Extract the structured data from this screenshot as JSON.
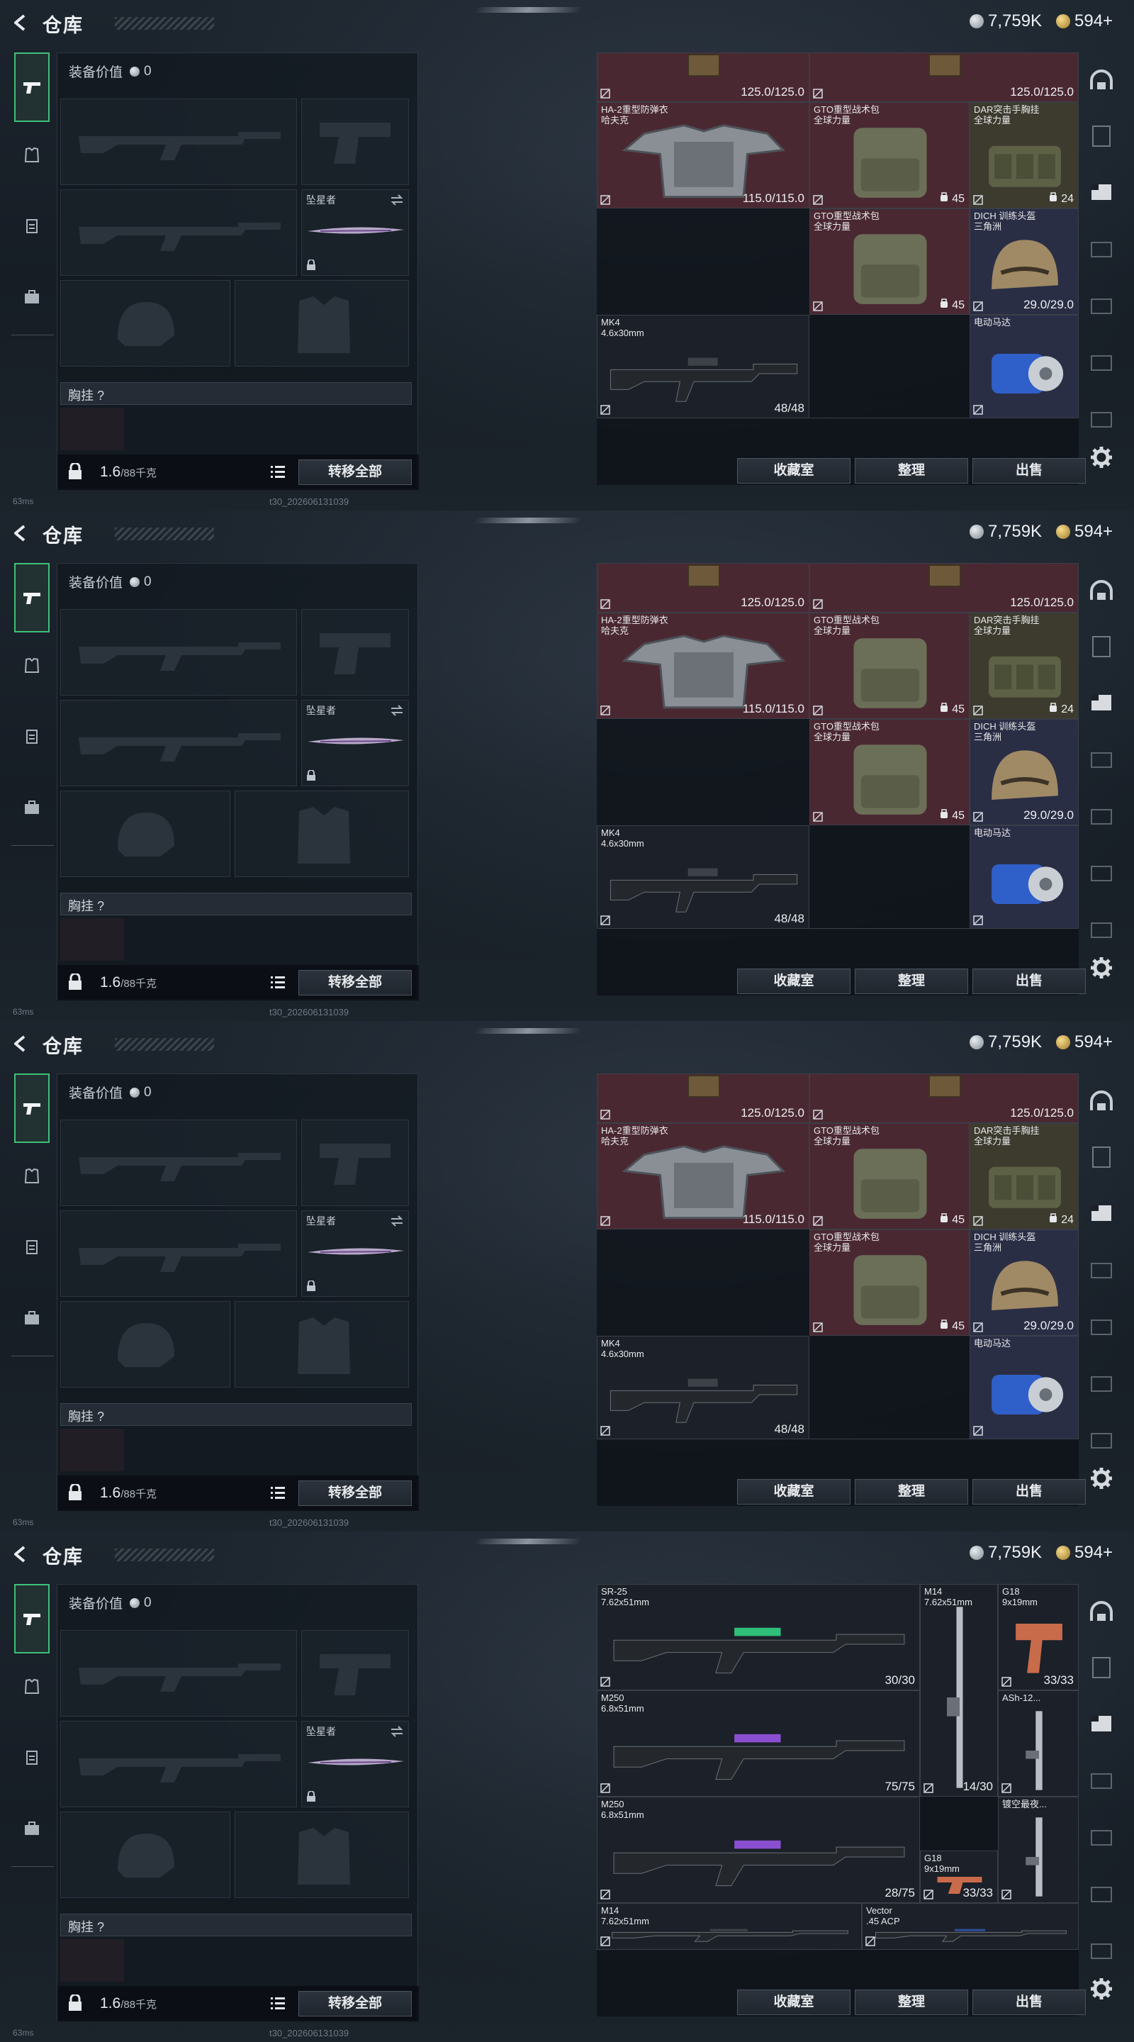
{
  "header": {
    "title": "仓库",
    "silver": "7,759K",
    "gold": "594+"
  },
  "equipment": {
    "value_label": "装备价值",
    "value": "0",
    "melee_name": "坠星者",
    "chest_label": "胸挂 ?",
    "weight": "1.6",
    "weight_max": "/88千克",
    "transfer_all": "转移全部"
  },
  "buttons": {
    "collection": "收藏室",
    "sort": "整理",
    "sell": "出售"
  },
  "footer": {
    "ping": "63ms",
    "build": "t30_202606131039"
  },
  "panels": [
    {
      "items": [
        {
          "name": "",
          "value": "125.0/125.0"
        },
        {
          "name": "",
          "value": "125.0/125.0"
        },
        {
          "name": "HA-2重型防弹衣\n哈夫克",
          "value": "115.0/115.0"
        },
        {
          "name": "GTO重型战术包\n全球力量",
          "value": "45"
        },
        {
          "name": "GTO重型战术包\n全球力量",
          "value": "45"
        },
        {
          "name": "DAR突击手胸挂\n全球力量",
          "value": "24"
        },
        {
          "name": "DICH 训练头盔\n三角洲",
          "value": "29.0/29.0"
        },
        {
          "name": "MK4\n4.6x30mm",
          "value": "48/48"
        },
        {
          "name": "电动马达",
          "value": ""
        }
      ]
    },
    {
      "items": [
        {
          "name": "",
          "value": "125.0/125.0"
        },
        {
          "name": "",
          "value": "125.0/125.0"
        },
        {
          "name": "HA-2重型防弹衣\n哈夫克",
          "value": "115.0/115.0"
        },
        {
          "name": "GTO重型战术包\n全球力量",
          "value": "45"
        },
        {
          "name": "GTO重型战术包\n全球力量",
          "value": "45"
        },
        {
          "name": "DAR突击手胸挂\n全球力量",
          "value": "24"
        },
        {
          "name": "DICH 训练头盔\n三角洲",
          "value": "29.0/29.0"
        },
        {
          "name": "MK4\n4.6x30mm",
          "value": "48/48"
        },
        {
          "name": "电动马达",
          "value": ""
        }
      ]
    },
    {
      "items": [
        {
          "name": "",
          "value": "125.0/125.0"
        },
        {
          "name": "",
          "value": "125.0/125.0"
        },
        {
          "name": "HA-2重型防弹衣\n哈夫克",
          "value": "115.0/115.0"
        },
        {
          "name": "GTO重型战术包\n全球力量",
          "value": "45"
        },
        {
          "name": "GTO重型战术包\n全球力量",
          "value": "45"
        },
        {
          "name": "DAR突击手胸挂\n全球力量",
          "value": "24"
        },
        {
          "name": "DICH 训练头盔\n三角洲",
          "value": "29.0/29.0"
        },
        {
          "name": "MK4\n4.6x30mm",
          "value": "48/48"
        },
        {
          "name": "电动马达",
          "value": ""
        }
      ]
    },
    {
      "items": [
        {
          "name": "SR-25\n7.62x51mm",
          "value": "30/30"
        },
        {
          "name": "M14\n7.62x51mm",
          "value": "14/30"
        },
        {
          "name": "G18\n9x19mm",
          "value": "33/33"
        },
        {
          "name": "M250\n6.8x51mm",
          "value": "75/75"
        },
        {
          "name": "ASh-12...",
          "value": ""
        },
        {
          "name": "M250\n6.8x51mm",
          "value": "28/75"
        },
        {
          "name": "G18\n9x19mm",
          "value": "33/33"
        },
        {
          "name": "镀空最夜...",
          "value": ""
        },
        {
          "name": "M14\n7.62x51mm",
          "value": ""
        },
        {
          "name": "Vector\n.45 ACP",
          "value": ""
        }
      ]
    }
  ],
  "colors": {
    "accent": "#3ec07a",
    "item_red": "#4a2832",
    "item_olive": "#3d3b2e",
    "item_blue": "#2a2e45"
  }
}
